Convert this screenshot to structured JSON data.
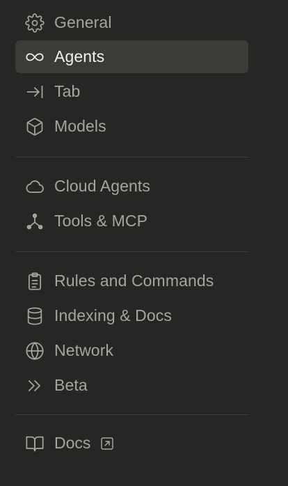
{
  "nav": {
    "group1": [
      {
        "label": "General",
        "icon": "gear-icon",
        "active": false
      },
      {
        "label": "Agents",
        "icon": "infinity-icon",
        "active": true
      },
      {
        "label": "Tab",
        "icon": "arrow-right-to-line-icon",
        "active": false
      },
      {
        "label": "Models",
        "icon": "cube-icon",
        "active": false
      }
    ],
    "group2": [
      {
        "label": "Cloud Agents",
        "icon": "cloud-icon",
        "active": false
      },
      {
        "label": "Tools & MCP",
        "icon": "network-nodes-icon",
        "active": false
      }
    ],
    "group3": [
      {
        "label": "Rules and Commands",
        "icon": "clipboard-icon",
        "active": false
      },
      {
        "label": "Indexing & Docs",
        "icon": "database-icon",
        "active": false
      },
      {
        "label": "Network",
        "icon": "globe-icon",
        "active": false
      },
      {
        "label": "Beta",
        "icon": "double-chevron-right-icon",
        "active": false
      }
    ],
    "group4": [
      {
        "label": "Docs",
        "icon": "book-icon",
        "external_icon": "external-link-icon",
        "active": false
      }
    ]
  },
  "colors": {
    "background": "#262624",
    "active_bg": "#3c3b37",
    "text": "#a6a59e",
    "active_text": "#f2f1ec",
    "divider": "#3e3d39"
  }
}
